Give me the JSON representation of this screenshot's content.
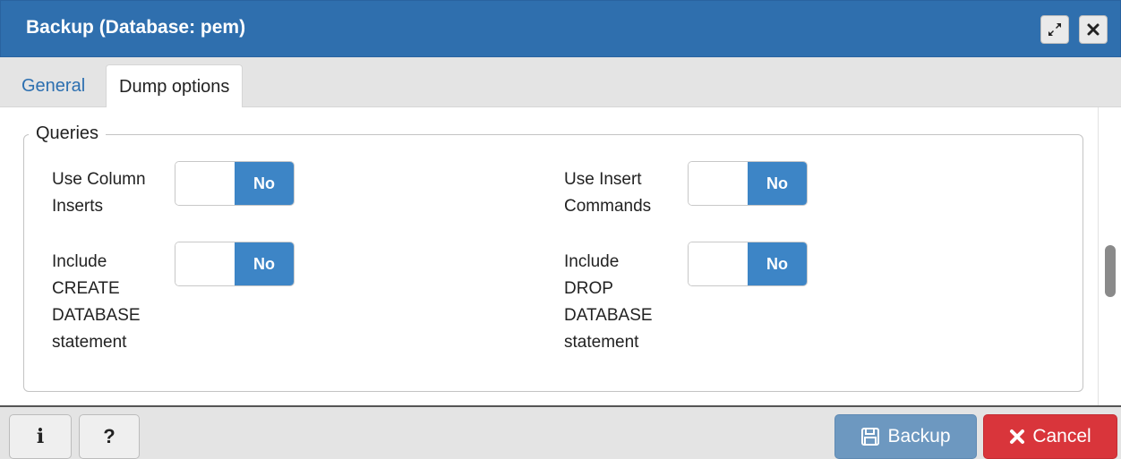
{
  "window": {
    "title": "Backup (Database: pem)",
    "expand_icon": "expand-icon",
    "close_icon": "close-icon"
  },
  "tabs": [
    {
      "label": "General",
      "active": false
    },
    {
      "label": "Dump options",
      "active": true
    }
  ],
  "queries": {
    "legend": "Queries",
    "options": [
      {
        "label": "Use Column Inserts",
        "value": "No"
      },
      {
        "label": "Use Insert Commands",
        "value": "No"
      },
      {
        "label": "Include CREATE DATABASE statement",
        "value": "No"
      },
      {
        "label": "Include DROP DATABASE statement",
        "value": "No"
      }
    ]
  },
  "footer": {
    "info_label": "i",
    "help_label": "?",
    "backup_label": "Backup",
    "cancel_label": "Cancel"
  },
  "colors": {
    "titlebar": "#2f6fae",
    "switch_on": "#3d85c6",
    "backup_button": "#6d98c0",
    "cancel_button": "#d9353b",
    "tab_link": "#2c6fb0"
  }
}
